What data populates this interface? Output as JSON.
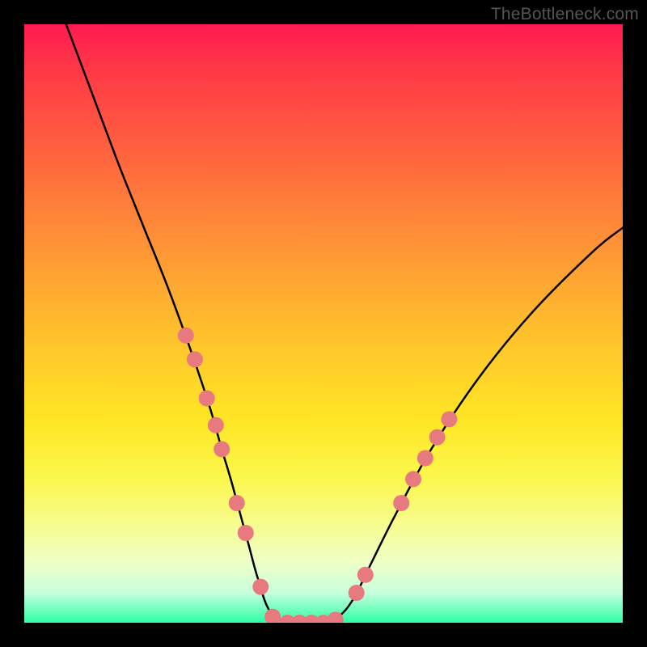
{
  "watermark": "TheBottleneck.com",
  "chart_data": {
    "type": "line",
    "title": "",
    "xlabel": "",
    "ylabel": "",
    "xlim": [
      0,
      100
    ],
    "ylim": [
      0,
      100
    ],
    "grid": false,
    "legend": false,
    "series": [
      {
        "name": "curve",
        "x": [
          7,
          10,
          13,
          16,
          20,
          24,
          28,
          31,
          33,
          34.5,
          36,
          37.5,
          39,
          41,
          44,
          47.5,
          50,
          52.5,
          55,
          58,
          62,
          68,
          76,
          85,
          95,
          100
        ],
        "y": [
          100,
          92,
          84,
          76,
          66,
          56,
          45,
          36,
          29,
          24,
          18.5,
          13,
          7.5,
          2,
          0,
          0,
          0,
          1,
          4,
          10,
          18,
          29,
          41,
          52,
          62,
          66
        ]
      }
    ],
    "markers": [
      {
        "x": 27.0,
        "y": 48.0
      },
      {
        "x": 28.5,
        "y": 44.0
      },
      {
        "x": 30.5,
        "y": 37.5
      },
      {
        "x": 32.0,
        "y": 33.0
      },
      {
        "x": 33.0,
        "y": 29.0
      },
      {
        "x": 35.5,
        "y": 20.0
      },
      {
        "x": 37.0,
        "y": 15.0
      },
      {
        "x": 39.5,
        "y": 6.0
      },
      {
        "x": 41.5,
        "y": 1.0
      },
      {
        "x": 44.0,
        "y": 0.0
      },
      {
        "x": 46.0,
        "y": 0.0
      },
      {
        "x": 48.0,
        "y": 0.0
      },
      {
        "x": 50.0,
        "y": 0.0
      },
      {
        "x": 52.0,
        "y": 0.5
      },
      {
        "x": 55.5,
        "y": 5.0
      },
      {
        "x": 57.0,
        "y": 8.0
      },
      {
        "x": 63.0,
        "y": 20.0
      },
      {
        "x": 65.0,
        "y": 24.0
      },
      {
        "x": 67.0,
        "y": 27.5
      },
      {
        "x": 69.0,
        "y": 31.0
      },
      {
        "x": 71.0,
        "y": 34.0
      }
    ],
    "marker_style": {
      "fill": "#e77a7e",
      "radius_px": 10
    },
    "background_gradient": {
      "top": "#ff1a52",
      "bottom": "#2dffa6"
    }
  }
}
